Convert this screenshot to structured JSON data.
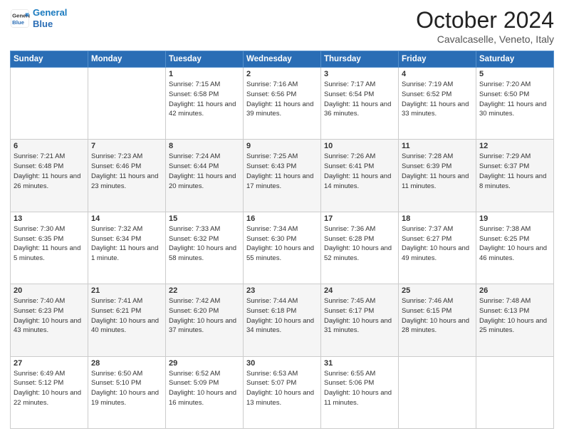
{
  "header": {
    "logo_line1": "General",
    "logo_line2": "Blue",
    "month": "October 2024",
    "location": "Cavalcaselle, Veneto, Italy"
  },
  "days_of_week": [
    "Sunday",
    "Monday",
    "Tuesday",
    "Wednesday",
    "Thursday",
    "Friday",
    "Saturday"
  ],
  "weeks": [
    [
      {
        "day": "",
        "info": ""
      },
      {
        "day": "",
        "info": ""
      },
      {
        "day": "1",
        "info": "Sunrise: 7:15 AM\nSunset: 6:58 PM\nDaylight: 11 hours and 42 minutes."
      },
      {
        "day": "2",
        "info": "Sunrise: 7:16 AM\nSunset: 6:56 PM\nDaylight: 11 hours and 39 minutes."
      },
      {
        "day": "3",
        "info": "Sunrise: 7:17 AM\nSunset: 6:54 PM\nDaylight: 11 hours and 36 minutes."
      },
      {
        "day": "4",
        "info": "Sunrise: 7:19 AM\nSunset: 6:52 PM\nDaylight: 11 hours and 33 minutes."
      },
      {
        "day": "5",
        "info": "Sunrise: 7:20 AM\nSunset: 6:50 PM\nDaylight: 11 hours and 30 minutes."
      }
    ],
    [
      {
        "day": "6",
        "info": "Sunrise: 7:21 AM\nSunset: 6:48 PM\nDaylight: 11 hours and 26 minutes."
      },
      {
        "day": "7",
        "info": "Sunrise: 7:23 AM\nSunset: 6:46 PM\nDaylight: 11 hours and 23 minutes."
      },
      {
        "day": "8",
        "info": "Sunrise: 7:24 AM\nSunset: 6:44 PM\nDaylight: 11 hours and 20 minutes."
      },
      {
        "day": "9",
        "info": "Sunrise: 7:25 AM\nSunset: 6:43 PM\nDaylight: 11 hours and 17 minutes."
      },
      {
        "day": "10",
        "info": "Sunrise: 7:26 AM\nSunset: 6:41 PM\nDaylight: 11 hours and 14 minutes."
      },
      {
        "day": "11",
        "info": "Sunrise: 7:28 AM\nSunset: 6:39 PM\nDaylight: 11 hours and 11 minutes."
      },
      {
        "day": "12",
        "info": "Sunrise: 7:29 AM\nSunset: 6:37 PM\nDaylight: 11 hours and 8 minutes."
      }
    ],
    [
      {
        "day": "13",
        "info": "Sunrise: 7:30 AM\nSunset: 6:35 PM\nDaylight: 11 hours and 5 minutes."
      },
      {
        "day": "14",
        "info": "Sunrise: 7:32 AM\nSunset: 6:34 PM\nDaylight: 11 hours and 1 minute."
      },
      {
        "day": "15",
        "info": "Sunrise: 7:33 AM\nSunset: 6:32 PM\nDaylight: 10 hours and 58 minutes."
      },
      {
        "day": "16",
        "info": "Sunrise: 7:34 AM\nSunset: 6:30 PM\nDaylight: 10 hours and 55 minutes."
      },
      {
        "day": "17",
        "info": "Sunrise: 7:36 AM\nSunset: 6:28 PM\nDaylight: 10 hours and 52 minutes."
      },
      {
        "day": "18",
        "info": "Sunrise: 7:37 AM\nSunset: 6:27 PM\nDaylight: 10 hours and 49 minutes."
      },
      {
        "day": "19",
        "info": "Sunrise: 7:38 AM\nSunset: 6:25 PM\nDaylight: 10 hours and 46 minutes."
      }
    ],
    [
      {
        "day": "20",
        "info": "Sunrise: 7:40 AM\nSunset: 6:23 PM\nDaylight: 10 hours and 43 minutes."
      },
      {
        "day": "21",
        "info": "Sunrise: 7:41 AM\nSunset: 6:21 PM\nDaylight: 10 hours and 40 minutes."
      },
      {
        "day": "22",
        "info": "Sunrise: 7:42 AM\nSunset: 6:20 PM\nDaylight: 10 hours and 37 minutes."
      },
      {
        "day": "23",
        "info": "Sunrise: 7:44 AM\nSunset: 6:18 PM\nDaylight: 10 hours and 34 minutes."
      },
      {
        "day": "24",
        "info": "Sunrise: 7:45 AM\nSunset: 6:17 PM\nDaylight: 10 hours and 31 minutes."
      },
      {
        "day": "25",
        "info": "Sunrise: 7:46 AM\nSunset: 6:15 PM\nDaylight: 10 hours and 28 minutes."
      },
      {
        "day": "26",
        "info": "Sunrise: 7:48 AM\nSunset: 6:13 PM\nDaylight: 10 hours and 25 minutes."
      }
    ],
    [
      {
        "day": "27",
        "info": "Sunrise: 6:49 AM\nSunset: 5:12 PM\nDaylight: 10 hours and 22 minutes."
      },
      {
        "day": "28",
        "info": "Sunrise: 6:50 AM\nSunset: 5:10 PM\nDaylight: 10 hours and 19 minutes."
      },
      {
        "day": "29",
        "info": "Sunrise: 6:52 AM\nSunset: 5:09 PM\nDaylight: 10 hours and 16 minutes."
      },
      {
        "day": "30",
        "info": "Sunrise: 6:53 AM\nSunset: 5:07 PM\nDaylight: 10 hours and 13 minutes."
      },
      {
        "day": "31",
        "info": "Sunrise: 6:55 AM\nSunset: 5:06 PM\nDaylight: 10 hours and 11 minutes."
      },
      {
        "day": "",
        "info": ""
      },
      {
        "day": "",
        "info": ""
      }
    ]
  ]
}
